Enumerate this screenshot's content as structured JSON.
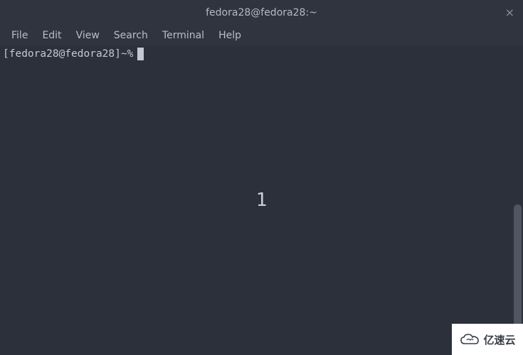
{
  "titlebar": {
    "title": "fedora28@fedora28:~",
    "close_glyph": "×"
  },
  "menubar": {
    "items": [
      {
        "label": "File"
      },
      {
        "label": "Edit"
      },
      {
        "label": "View"
      },
      {
        "label": "Search"
      },
      {
        "label": "Terminal"
      },
      {
        "label": "Help"
      }
    ]
  },
  "terminal": {
    "prompt": "[fedora28@fedora28]~%",
    "center_overlay": "1"
  },
  "watermark": {
    "brand": "亿速云"
  }
}
